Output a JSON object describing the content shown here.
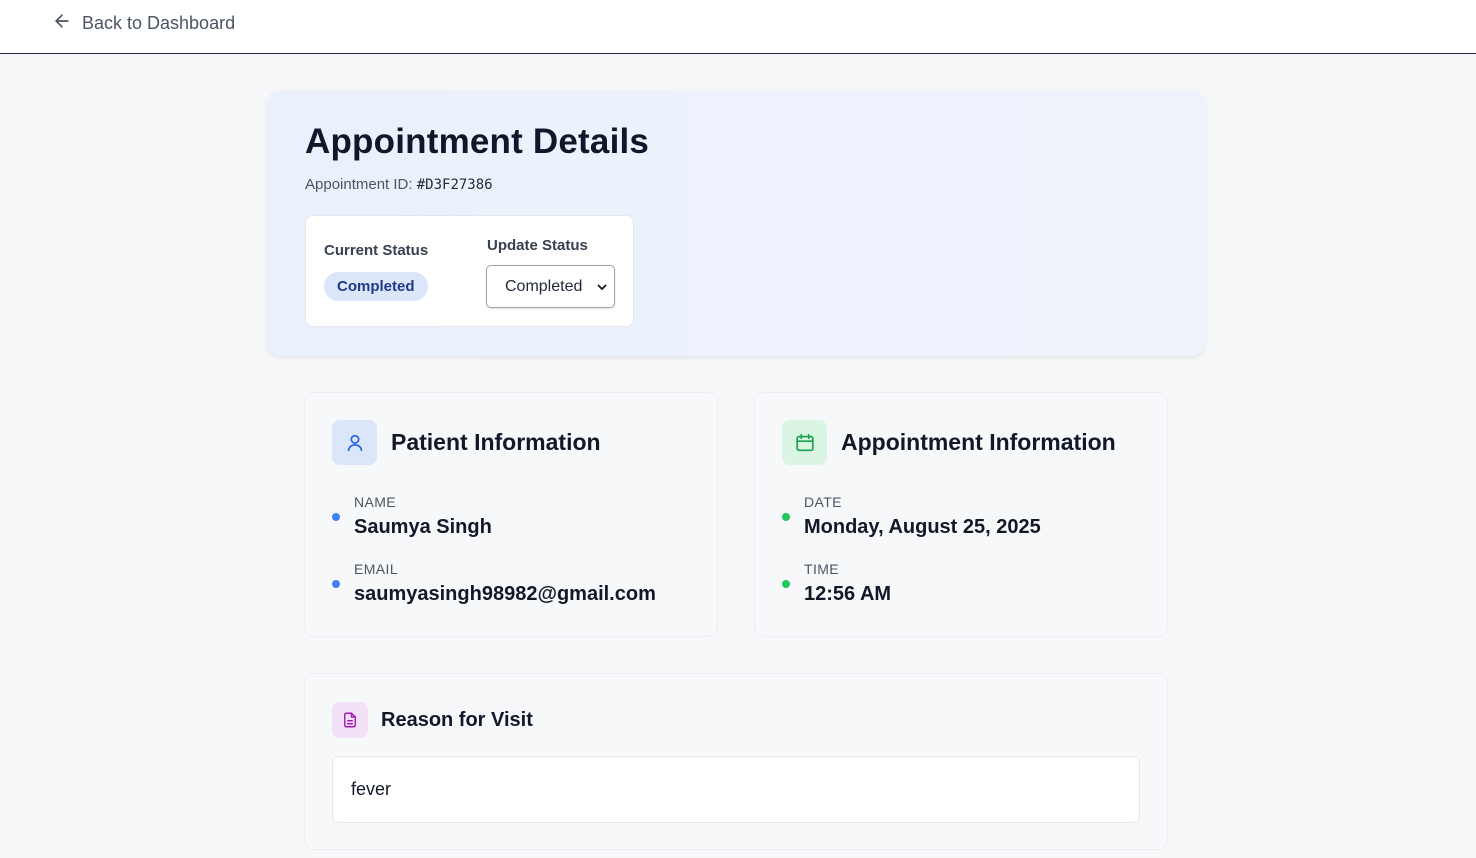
{
  "nav": {
    "back_label": "Back to Dashboard"
  },
  "header": {
    "title": "Appointment Details",
    "id_label": "Appointment ID:",
    "id_value": "#D3F27386",
    "current_status_label": "Current Status",
    "current_status_value": "Completed",
    "update_status_label": "Update Status",
    "update_status_selected": "Completed"
  },
  "patient": {
    "title": "Patient Information",
    "name_label": "NAME",
    "name_value": "Saumya Singh",
    "email_label": "EMAIL",
    "email_value": "saumyasingh98982@gmail.com"
  },
  "appointment": {
    "title": "Appointment Information",
    "date_label": "DATE",
    "date_value": "Monday, August 25, 2025",
    "time_label": "TIME",
    "time_value": "12:56 AM"
  },
  "reason": {
    "title": "Reason for Visit",
    "text": "fever"
  },
  "colors": {
    "status_pill_bg": "#dbe7f9",
    "status_pill_text": "#1e3a8a",
    "patient_accent": "#3b82f6",
    "appointment_accent": "#22c55e",
    "reason_accent": "#a21caf"
  }
}
